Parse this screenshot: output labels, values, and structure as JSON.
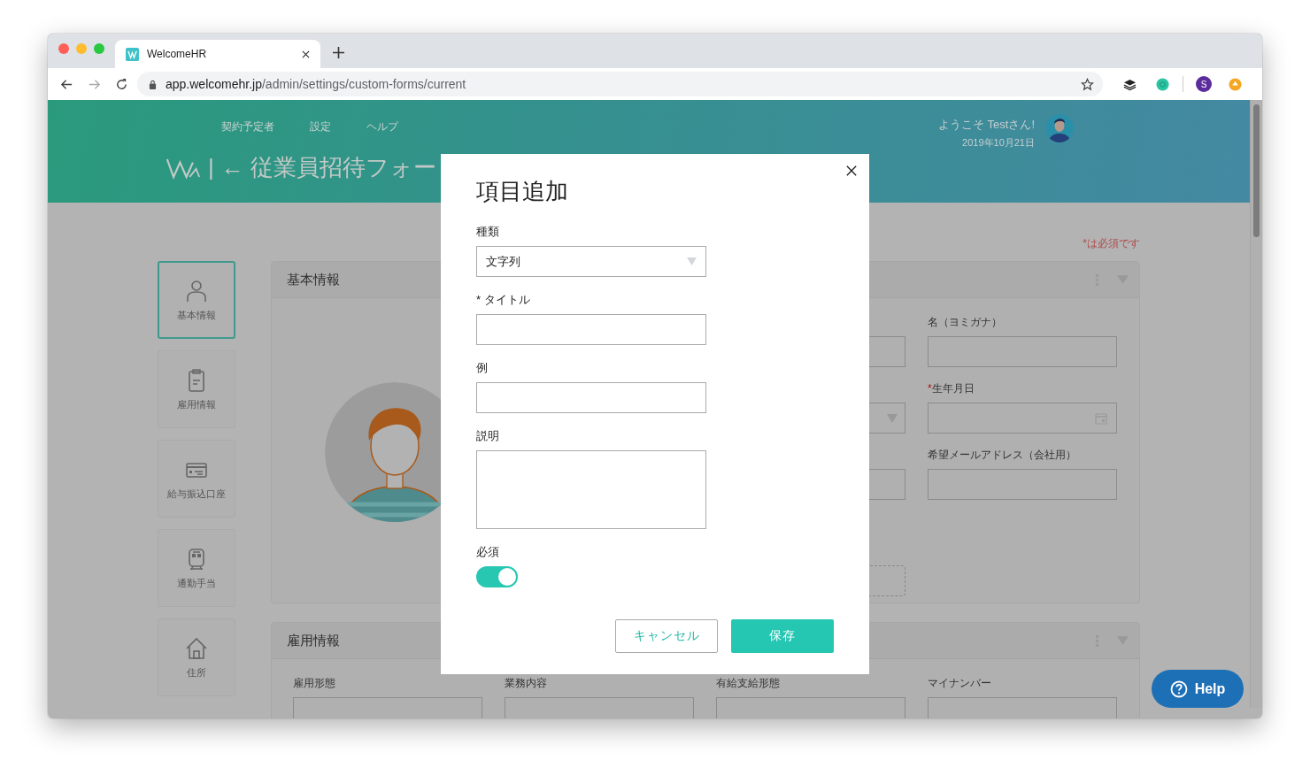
{
  "browser": {
    "tab_title": "WelcomeHR",
    "url_host": "app.welcomehr.jp",
    "url_path": "/admin/settings/custom-forms/current",
    "profile_initial": "S"
  },
  "header": {
    "nav": [
      "契約予定者",
      "設定",
      "ヘルプ"
    ],
    "title_separator": "|",
    "title": "← 従業員招待フォー",
    "greeting": "ようこそ Testさん!",
    "date": "2019年10月21日"
  },
  "required_note": "*は必須です",
  "sidebar": [
    {
      "label": "基本情報",
      "selected": true
    },
    {
      "label": "雇用情報",
      "selected": false
    },
    {
      "label": "給与振込口座",
      "selected": false
    },
    {
      "label": "通勤手当",
      "selected": false
    },
    {
      "label": "住所",
      "selected": false
    }
  ],
  "sections": [
    {
      "title": "基本情報",
      "kind": "profile",
      "partial_fields": [
        {
          "kind": "text"
        },
        {
          "kind": "select"
        },
        {
          "kind": "text"
        },
        {
          "kind": "dashed"
        }
      ],
      "fields": [
        {
          "label": "名（ヨミガナ）",
          "kind": "text"
        },
        {
          "required_mark": "*",
          "label": "生年月日",
          "kind": "date"
        },
        {
          "label": "希望メールアドレス（会社用）",
          "kind": "text"
        }
      ]
    },
    {
      "title": "雇用情報",
      "kind": "grid",
      "fields": [
        {
          "label": "雇用形態",
          "kind": "text"
        },
        {
          "label": "業務内容",
          "kind": "text"
        },
        {
          "label": "有給支給形態",
          "kind": "text"
        },
        {
          "label": "マイナンバー",
          "kind": "text"
        }
      ]
    }
  ],
  "modal": {
    "title": "項目追加",
    "fields": [
      {
        "label": "種類",
        "kind": "select",
        "value": "文字列"
      },
      {
        "label": "* タイトル",
        "kind": "text"
      },
      {
        "label": "例",
        "kind": "text"
      },
      {
        "label": "説明",
        "kind": "textarea"
      },
      {
        "label": "必須",
        "kind": "toggle",
        "on": true
      }
    ],
    "buttons": [
      {
        "label": "キャンセル",
        "kind": "secondary"
      },
      {
        "label": "保存",
        "kind": "primary"
      }
    ]
  },
  "help_button": "Help"
}
